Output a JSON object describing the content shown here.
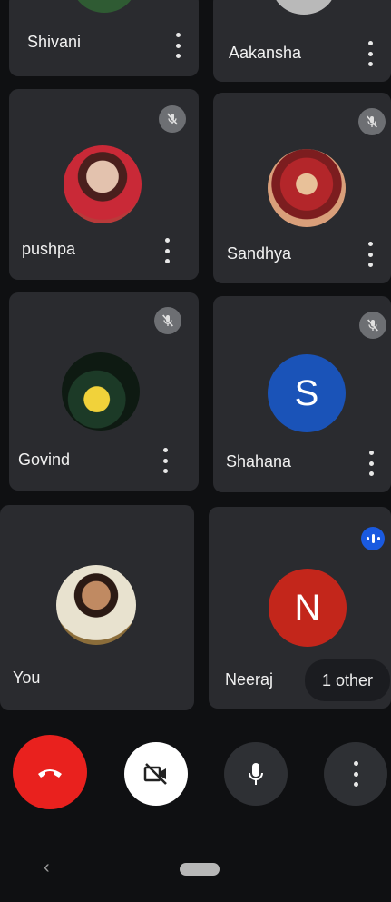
{
  "participants": [
    {
      "name": "Shivani"
    },
    {
      "name": "Aakansha"
    },
    {
      "name": "pushpa"
    },
    {
      "name": "Sandhya"
    },
    {
      "name": "Govind"
    },
    {
      "name": "Shahana",
      "initial": "S",
      "color": "#1a53b8"
    },
    {
      "name": "You"
    },
    {
      "name": "Neeraj",
      "initial": "N",
      "color": "#c3261b"
    }
  ],
  "others_badge": "1 other",
  "controls": {
    "end_call_color": "#e9211e",
    "camera_bg": "#ffffff",
    "button_bg": "#2e3034"
  },
  "speaking_indicator_color": "#1a5ae0"
}
